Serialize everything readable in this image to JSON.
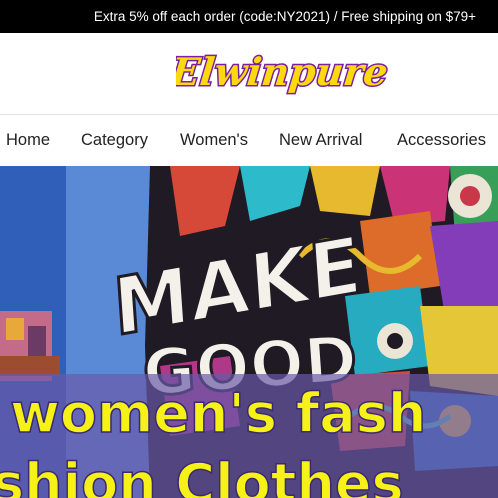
{
  "announcement": {
    "text": "Extra 5% off each order (code:NY2021) / Free shipping on $79+"
  },
  "brand": {
    "name": "Elwinpure"
  },
  "nav": {
    "items": [
      {
        "label": "Home"
      },
      {
        "label": "Category"
      },
      {
        "label": "Women's"
      },
      {
        "label": "New Arrival"
      },
      {
        "label": "Accessories"
      }
    ]
  },
  "hero": {
    "mural_text_line1": "MAKE",
    "mural_text_line2": "GOOD",
    "headline_line1": "women's fash",
    "headline_line2": "shion Clothes"
  },
  "colors": {
    "announcement_bg": "#000000",
    "logo_fill": "#fbd90f",
    "logo_outline": "#7b1fa2",
    "headline_yellow": "#f6f116",
    "headline_band": "#6a5aa8",
    "sky_blue": "#3f74c9"
  }
}
